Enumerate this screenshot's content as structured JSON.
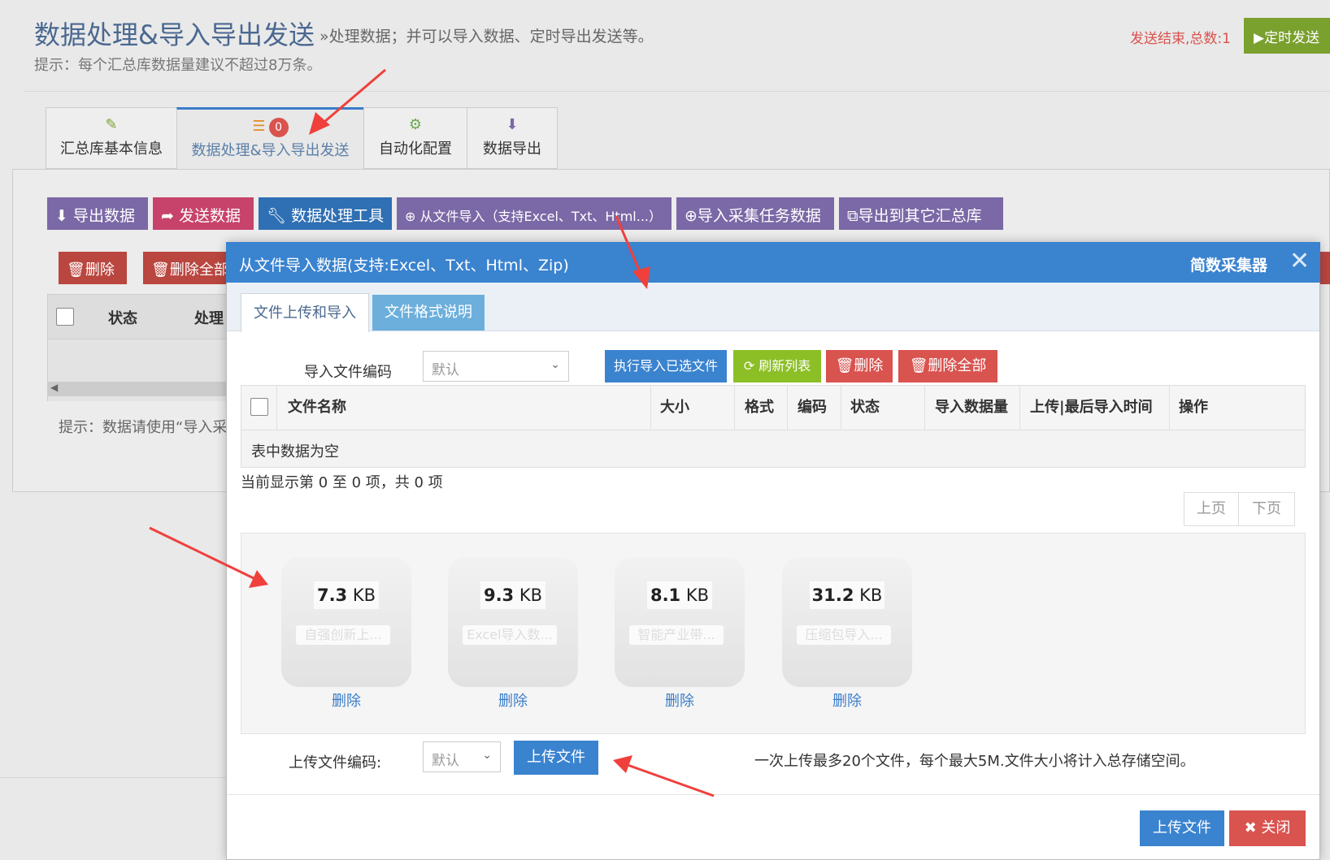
{
  "header": {
    "title": "数据处理&导入导出发送",
    "subtitle": "»处理数据；并可以导入数据、定时导出发送等。",
    "tip": "提示：每个汇总库数据量建议不超过8万条。",
    "send_status": "发送结束,总数:1",
    "timer_button": "▶定时发送"
  },
  "tabs": [
    {
      "label": "汇总库基本信息",
      "icon": "edit-icon"
    },
    {
      "label": "数据处理&导入导出发送",
      "icon": "database-icon",
      "badge": "0"
    },
    {
      "label": "自动化配置",
      "icon": "gears-icon"
    },
    {
      "label": "数据导出",
      "icon": "download-icon"
    }
  ],
  "toolbar": {
    "export": "导出数据",
    "send": "发送数据",
    "tools": "数据处理工具",
    "import_file": "从文件导入（支持Excel、Txt、Html...）",
    "import_task": "导入采集任务数据",
    "export_other": "导出到其它汇总库"
  },
  "background_table": {
    "delete": "删除",
    "delete_all": "删除全部",
    "col_status": "状态",
    "col_process": "处理",
    "tip": "提示：数据请使用“导入采"
  },
  "modal": {
    "title": "从文件导入数据(支持:Excel、Txt、Html、Zip)",
    "brand": "简数采集器",
    "close_icon": "close-icon",
    "tabs": [
      "文件上传和导入",
      "文件格式说明"
    ],
    "encoding_label": "导入文件编码",
    "encoding_value": "默认",
    "btn_run_import": "执行导入已选文件",
    "btn_refresh": "刷新列表",
    "btn_delete": "删除",
    "btn_delete_all": "删除全部",
    "columns": [
      "文件名称",
      "大小",
      "格式",
      "编码",
      "状态",
      "导入数据量",
      "上传|最后导入时间",
      "操作"
    ],
    "empty_text": "表中数据为空",
    "info": "当前显示第 0 至 0 项，共 0 项",
    "pager_prev": "上页",
    "pager_next": "下页",
    "files": [
      {
        "size_num": "7.3",
        "size_unit": "KB",
        "name": "自强创新上...",
        "delete": "删除"
      },
      {
        "size_num": "9.3",
        "size_unit": "KB",
        "name": "Excel导入数...",
        "delete": "删除"
      },
      {
        "size_num": "8.1",
        "size_unit": "KB",
        "name": "智能产业带...",
        "delete": "删除"
      },
      {
        "size_num": "31.2",
        "size_unit": "KB",
        "name": "压缩包导入...",
        "delete": "删除"
      }
    ],
    "upload_encoding_label": "上传文件编码:",
    "upload_encoding_value": "默认",
    "upload_button": "上传文件",
    "upload_note": "一次上传最多20个文件，每个最大5M.文件大小将计入总存储空间。",
    "footer_upload": "上传文件",
    "footer_close": "✖ 关闭"
  },
  "colors": {
    "modal_header": "#3a83cf",
    "primary": "#3a83cf",
    "success": "#8cbf26",
    "danger": "#d9534f",
    "purple": "#7b68a6",
    "pink": "#c7436b",
    "annotation_arrow": "#f0403c"
  }
}
